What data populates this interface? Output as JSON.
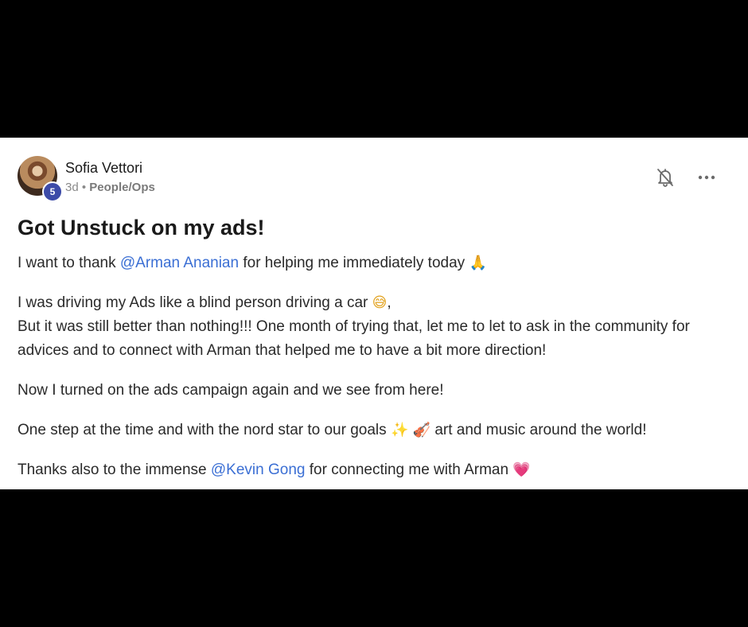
{
  "author": {
    "name": "Sofia Vettori",
    "level": "5",
    "time_ago": "3d",
    "separator": "•",
    "category": "People/Ops"
  },
  "post": {
    "title": "Got Unstuck on my ads!",
    "p1": {
      "before": "I want to thank ",
      "mention": "@Arman Ananian",
      "after": " for helping me immediately today ",
      "emoji": "🙏"
    },
    "p2": {
      "line1": "I was driving my Ads like a blind person driving a car ",
      "emoji": "😅",
      "line1_end": ",",
      "line2": "But it was still better than nothing!!! One month of trying that, let me to let to ask in the community for advices and to connect with Arman that helped me to have a bit more direction!"
    },
    "p3": "Now I turned on the ads campaign again and we see from here!",
    "p4": {
      "before": "One step at the time and with the nord star to our goals ",
      "emoji1": "✨",
      "emoji2": "🎻",
      "after": " art and music around the world!"
    },
    "p5": {
      "before": "Thanks also to the immense ",
      "mention": "@Kevin Gong",
      "after": " for connecting me with Arman ",
      "emoji": "💗"
    }
  },
  "icons": {
    "mute": "bell-off-icon",
    "more": "more-options-icon"
  },
  "colors": {
    "mention": "#3b6fd4",
    "badge": "#3d4ba8",
    "background": "#000000",
    "card": "#ffffff"
  }
}
